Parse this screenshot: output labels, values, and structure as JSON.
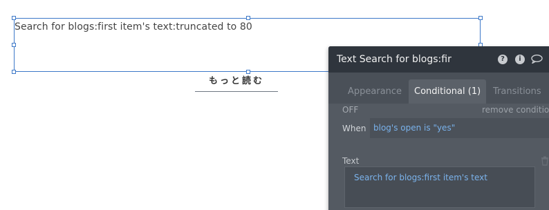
{
  "canvas": {
    "text_element_content": "Search for blogs:first item's text:truncated to 80",
    "more_button_label": "もっと読む"
  },
  "panel": {
    "title": "Text Search for blogs:fir",
    "header_icons": [
      "help-icon",
      "info-icon",
      "comment-icon"
    ],
    "help_glyph": "?",
    "info_glyph": "i",
    "tabs": [
      {
        "label": "Appearance",
        "active": false
      },
      {
        "label": "Conditional (1)",
        "active": true
      },
      {
        "label": "Transitions",
        "active": false
      }
    ],
    "condition": {
      "status": "OFF",
      "remove_label": "remove condition",
      "when_label": "When",
      "when_expression": "blog's open is \"yes\""
    },
    "property": {
      "label": "Text",
      "value": "Search for blogs:first item's text"
    }
  },
  "colors": {
    "selection": "#3c78c8",
    "panel_bg": "#545a62",
    "panel_header": "#2f353d",
    "dynamic_expression": "#79b2ec"
  }
}
